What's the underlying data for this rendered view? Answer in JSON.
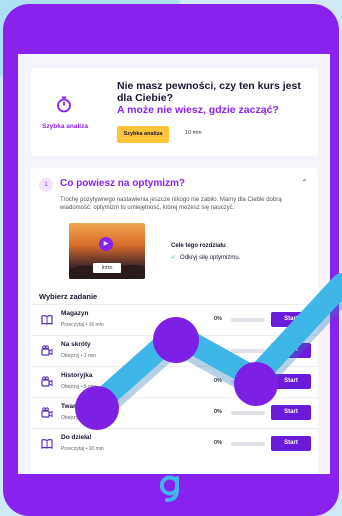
{
  "promo": {
    "title": "Nie masz pewności, czy ten kurs jest dla Ciebie?",
    "subtitle": "A może nie wiesz, gdzie zacząć?",
    "quick_label": "Szybka analiza",
    "button_label": "Szybka analiza",
    "time": "10 min"
  },
  "section": {
    "number": "1",
    "title": "Co powiesz na optymizm?",
    "description": "Trochę pozytywnego nastawienia jeszcze nikogo nie zabiło. Mamy dla Ciebie dobrą wiadomość: optymizm to umiejętność, której możesz się nauczyć.",
    "video_label": "Intro",
    "goals_title": "Cele tego rozdziału",
    "goal": "Odkryj siłę optymizmu."
  },
  "tasks_title": "Wybierz zadanie",
  "tasks": [
    {
      "name": "Magazyn",
      "meta": "Przeczytaj • 16 min",
      "progress": "0%",
      "start": "Start",
      "icon": "book-icon"
    },
    {
      "name": "Na skróty",
      "meta": "Obejrzyj • 1 min",
      "progress": "0%",
      "start": "Start",
      "icon": "video-icon"
    },
    {
      "name": "Historyjka",
      "meta": "Obejrzyj • 5 min",
      "progress": "0%",
      "start": "Start",
      "icon": "video-icon"
    },
    {
      "name": "Twarz",
      "meta": "Obejrzyj",
      "progress": "0%",
      "start": "Start",
      "icon": "video-icon"
    },
    {
      "name": "Do dzieła!",
      "meta": "Przeczytaj • 10 min",
      "progress": "0%",
      "start": "Start",
      "icon": "book-icon"
    }
  ],
  "colors": {
    "accent": "#8a22ef",
    "cta": "#ffc43a",
    "overlay_line": "#3fb6e8"
  }
}
